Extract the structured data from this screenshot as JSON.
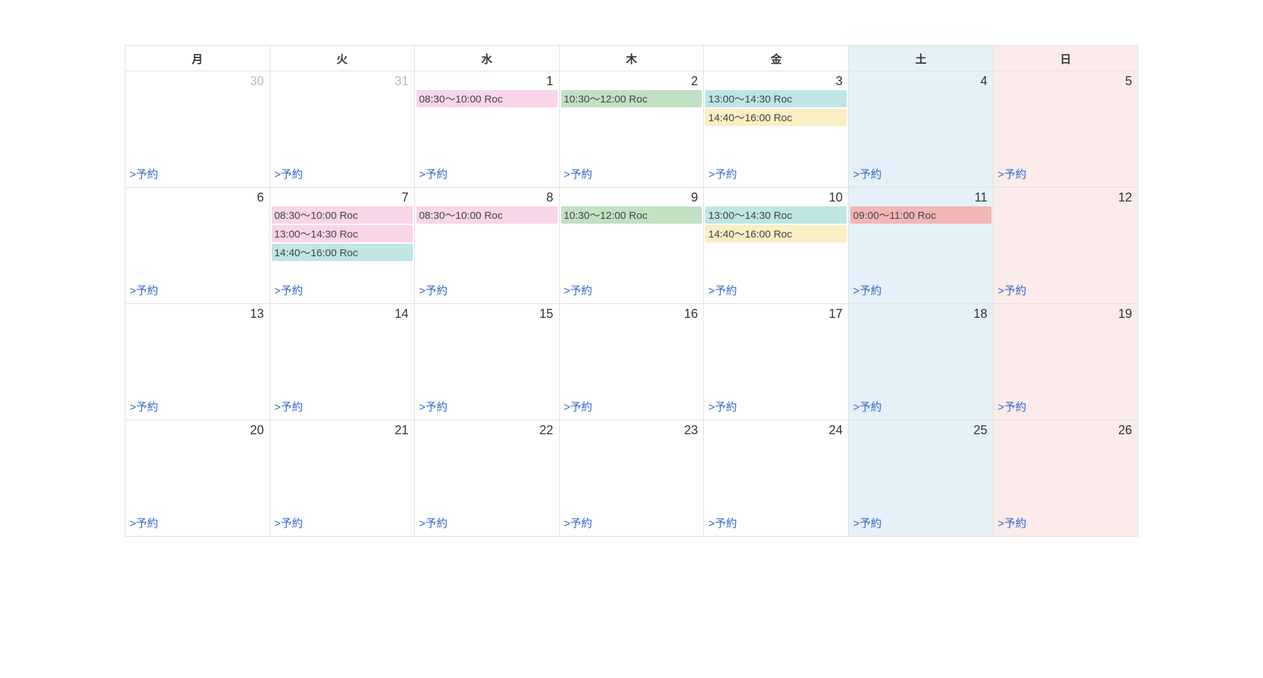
{
  "weekdays": [
    "月",
    "火",
    "水",
    "木",
    "金",
    "土",
    "日"
  ],
  "reserve_label": ">予約",
  "event_colors": {
    "pink": "#f8d5e8",
    "green": "#c2e0c2",
    "cyan": "#bfe5e5",
    "yellow": "#f9edc2",
    "red": "#f3b6b6"
  },
  "weeks": [
    [
      {
        "num": "30",
        "other_month": true,
        "type": "weekday",
        "events": []
      },
      {
        "num": "31",
        "other_month": true,
        "type": "weekday",
        "events": []
      },
      {
        "num": "1",
        "other_month": false,
        "type": "weekday",
        "events": [
          {
            "label": "08:30～10:00 Roc",
            "color": "pink"
          }
        ]
      },
      {
        "num": "2",
        "other_month": false,
        "type": "weekday",
        "events": [
          {
            "label": "10:30～12:00 Roc",
            "color": "green"
          }
        ]
      },
      {
        "num": "3",
        "other_month": false,
        "type": "weekday",
        "events": [
          {
            "label": "13:00～14:30 Roc",
            "color": "cyan"
          },
          {
            "label": "14:40～16:00 Roc",
            "color": "yellow"
          }
        ]
      },
      {
        "num": "4",
        "other_month": false,
        "type": "sat",
        "events": []
      },
      {
        "num": "5",
        "other_month": false,
        "type": "sun",
        "events": []
      }
    ],
    [
      {
        "num": "6",
        "other_month": false,
        "type": "weekday",
        "events": []
      },
      {
        "num": "7",
        "other_month": false,
        "type": "weekday",
        "events": [
          {
            "label": "08:30～10:00 Roc",
            "color": "pink"
          },
          {
            "label": "13:00～14:30 Roc",
            "color": "pink"
          },
          {
            "label": "14:40～16:00 Roc",
            "color": "cyan"
          }
        ]
      },
      {
        "num": "8",
        "other_month": false,
        "type": "weekday",
        "events": [
          {
            "label": "08:30～10:00 Roc",
            "color": "pink"
          }
        ]
      },
      {
        "num": "9",
        "other_month": false,
        "type": "weekday",
        "events": [
          {
            "label": "10:30～12:00 Roc",
            "color": "green"
          }
        ]
      },
      {
        "num": "10",
        "other_month": false,
        "type": "weekday",
        "events": [
          {
            "label": "13:00～14:30 Roc",
            "color": "cyan"
          },
          {
            "label": "14:40～16:00 Roc",
            "color": "yellow"
          }
        ]
      },
      {
        "num": "11",
        "other_month": false,
        "type": "sat",
        "events": [
          {
            "label": "09:00～11:00 Roc",
            "color": "red"
          }
        ]
      },
      {
        "num": "12",
        "other_month": false,
        "type": "sun",
        "events": []
      }
    ],
    [
      {
        "num": "13",
        "other_month": false,
        "type": "weekday",
        "events": []
      },
      {
        "num": "14",
        "other_month": false,
        "type": "weekday",
        "events": []
      },
      {
        "num": "15",
        "other_month": false,
        "type": "weekday",
        "events": []
      },
      {
        "num": "16",
        "other_month": false,
        "type": "weekday",
        "events": []
      },
      {
        "num": "17",
        "other_month": false,
        "type": "weekday",
        "events": []
      },
      {
        "num": "18",
        "other_month": false,
        "type": "sat",
        "events": []
      },
      {
        "num": "19",
        "other_month": false,
        "type": "sun",
        "events": []
      }
    ],
    [
      {
        "num": "20",
        "other_month": false,
        "type": "weekday",
        "events": []
      },
      {
        "num": "21",
        "other_month": false,
        "type": "weekday",
        "events": []
      },
      {
        "num": "22",
        "other_month": false,
        "type": "weekday",
        "events": []
      },
      {
        "num": "23",
        "other_month": false,
        "type": "weekday",
        "events": []
      },
      {
        "num": "24",
        "other_month": false,
        "type": "weekday",
        "events": []
      },
      {
        "num": "25",
        "other_month": false,
        "type": "sat",
        "events": []
      },
      {
        "num": "26",
        "other_month": false,
        "type": "sun",
        "events": []
      }
    ]
  ]
}
